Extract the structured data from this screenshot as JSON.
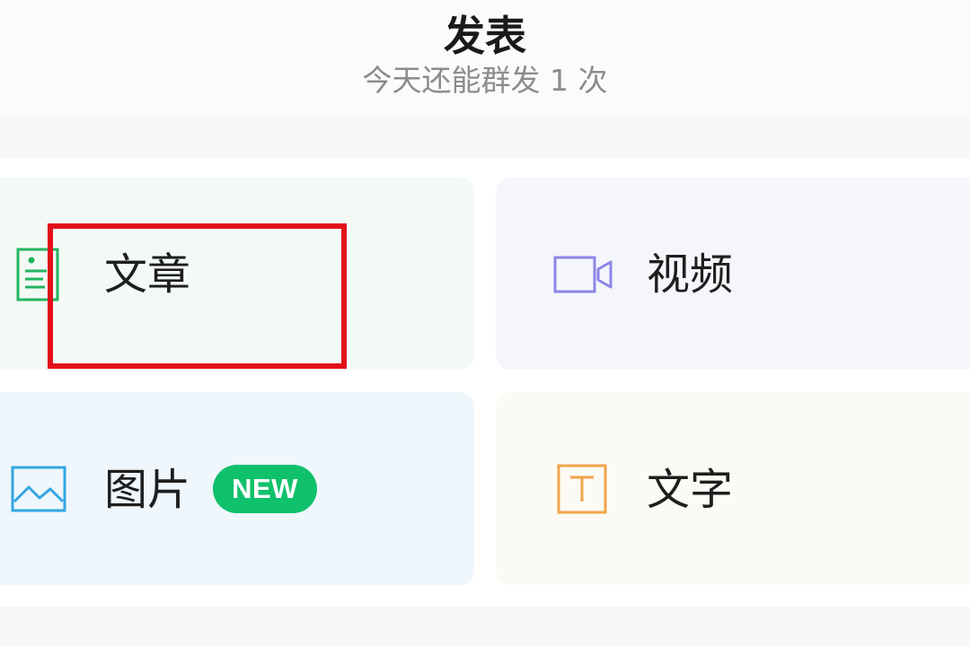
{
  "header": {
    "title": "发表",
    "subtitle": "今天还能群发 1 次"
  },
  "options": [
    {
      "key": "article",
      "label": "文章",
      "icon": "article-icon",
      "color": "#22b55f"
    },
    {
      "key": "video",
      "label": "视频",
      "icon": "video-camera-icon",
      "color": "#8d86e8"
    },
    {
      "key": "image",
      "label": "图片",
      "icon": "image-icon",
      "color": "#33a6e3",
      "badge": "NEW"
    },
    {
      "key": "text",
      "label": "文字",
      "icon": "text-icon",
      "color": "#f0a54a"
    }
  ],
  "colors": {
    "badge": "#10c16c",
    "highlight": "#e3101a"
  }
}
